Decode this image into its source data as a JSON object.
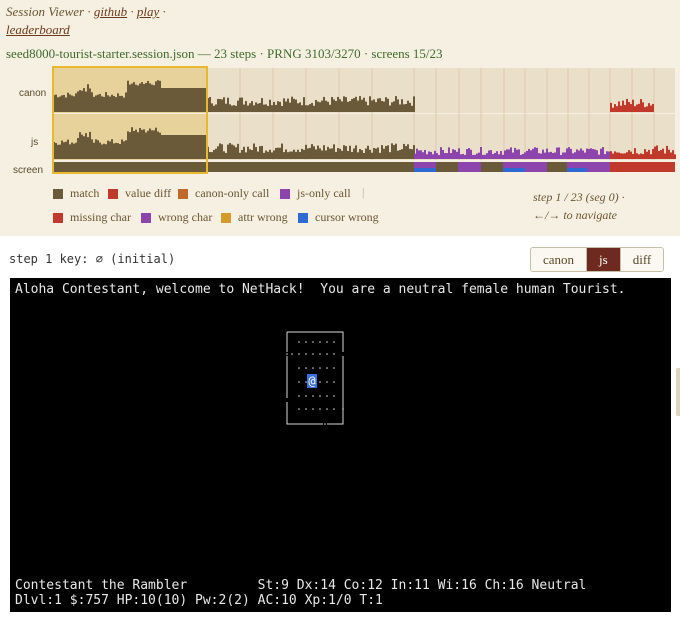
{
  "nav": {
    "title": "Session Viewer",
    "sep": "·",
    "links": [
      "github",
      "play",
      "leaderboard"
    ]
  },
  "session": {
    "file": "seed8000-tourist-starter.session.json",
    "steps": "23 steps",
    "prng": "PRNG 3103/3270",
    "screens": "screens 15/23",
    "full": "seed8000-tourist-starter.session.json — 23 steps · PRNG 3103/3270 · screens 15/23"
  },
  "rows": {
    "canon": "canon",
    "js": "js",
    "screen": "screen"
  },
  "legend": [
    {
      "label": "match",
      "color": "#6b5a3a"
    },
    {
      "label": "value diff",
      "color": "#c0392b"
    },
    {
      "label": "canon-only call",
      "color": "#c0692b"
    },
    {
      "label": "js-only call",
      "color": "#8e44ad"
    },
    {
      "label": "|",
      "color": ""
    },
    {
      "label": "missing char",
      "color": "#c0392b"
    },
    {
      "label": "wrong char",
      "color": "#8e44ad"
    },
    {
      "label": "attr wrong",
      "color": "#d49a2a"
    },
    {
      "label": "cursor wrong",
      "color": "#2e6ad1"
    }
  ],
  "step_info": {
    "line1": "step 1 / 23 (seg 0) ·",
    "line2": "←/→ to navigate"
  },
  "step_key": "step 1 key: ∅ (initial)",
  "tabs": {
    "canon": "canon",
    "js": "js",
    "diff": "diff",
    "active": "js"
  },
  "terminal": {
    "message": "Aloha Contestant, welcome to NetHack!  You are a neutral female human Tourist.",
    "status1": "Contestant the Rambler         St:9 Dx:14 Co:12 In:11 Wi:16 Ch:16 Neutral",
    "status2": "Dlvl:1 $:757 HP:10(10) Pw:2(2) AC:10 Xp:1/0 T:1",
    "player_glyph": "@"
  },
  "colors": {
    "match": "#6b5a3a",
    "value_diff": "#c0392b",
    "js_only": "#8e44ad",
    "cursor": "#2e6ad1",
    "tab_active": "#6e2a1e",
    "session_text": "#3d6b2a"
  }
}
